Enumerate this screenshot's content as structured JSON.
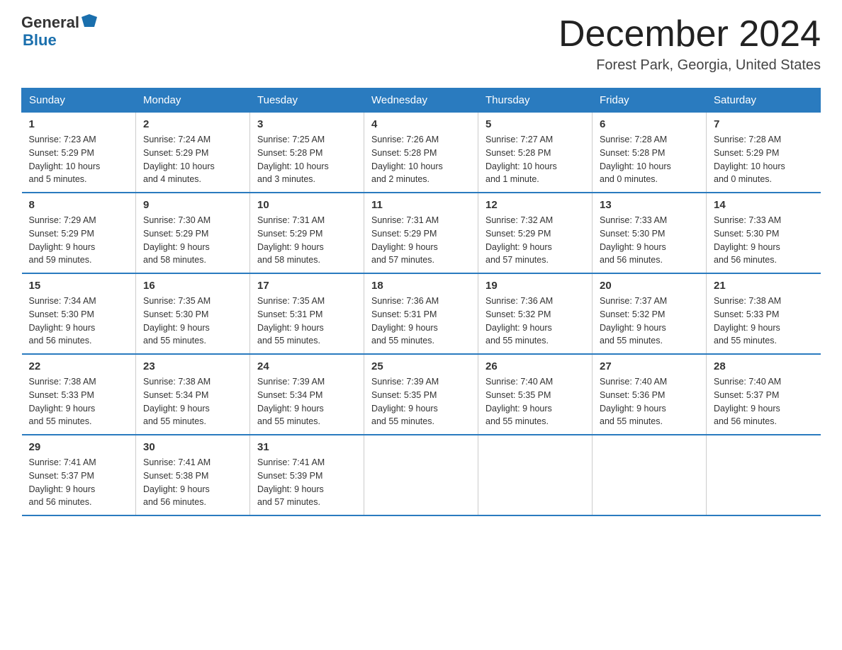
{
  "header": {
    "logo_general": "General",
    "logo_blue": "Blue",
    "month": "December 2024",
    "location": "Forest Park, Georgia, United States"
  },
  "weekdays": [
    "Sunday",
    "Monday",
    "Tuesday",
    "Wednesday",
    "Thursday",
    "Friday",
    "Saturday"
  ],
  "weeks": [
    [
      {
        "day": "1",
        "info": "Sunrise: 7:23 AM\nSunset: 5:29 PM\nDaylight: 10 hours\nand 5 minutes."
      },
      {
        "day": "2",
        "info": "Sunrise: 7:24 AM\nSunset: 5:29 PM\nDaylight: 10 hours\nand 4 minutes."
      },
      {
        "day": "3",
        "info": "Sunrise: 7:25 AM\nSunset: 5:28 PM\nDaylight: 10 hours\nand 3 minutes."
      },
      {
        "day": "4",
        "info": "Sunrise: 7:26 AM\nSunset: 5:28 PM\nDaylight: 10 hours\nand 2 minutes."
      },
      {
        "day": "5",
        "info": "Sunrise: 7:27 AM\nSunset: 5:28 PM\nDaylight: 10 hours\nand 1 minute."
      },
      {
        "day": "6",
        "info": "Sunrise: 7:28 AM\nSunset: 5:28 PM\nDaylight: 10 hours\nand 0 minutes."
      },
      {
        "day": "7",
        "info": "Sunrise: 7:28 AM\nSunset: 5:29 PM\nDaylight: 10 hours\nand 0 minutes."
      }
    ],
    [
      {
        "day": "8",
        "info": "Sunrise: 7:29 AM\nSunset: 5:29 PM\nDaylight: 9 hours\nand 59 minutes."
      },
      {
        "day": "9",
        "info": "Sunrise: 7:30 AM\nSunset: 5:29 PM\nDaylight: 9 hours\nand 58 minutes."
      },
      {
        "day": "10",
        "info": "Sunrise: 7:31 AM\nSunset: 5:29 PM\nDaylight: 9 hours\nand 58 minutes."
      },
      {
        "day": "11",
        "info": "Sunrise: 7:31 AM\nSunset: 5:29 PM\nDaylight: 9 hours\nand 57 minutes."
      },
      {
        "day": "12",
        "info": "Sunrise: 7:32 AM\nSunset: 5:29 PM\nDaylight: 9 hours\nand 57 minutes."
      },
      {
        "day": "13",
        "info": "Sunrise: 7:33 AM\nSunset: 5:30 PM\nDaylight: 9 hours\nand 56 minutes."
      },
      {
        "day": "14",
        "info": "Sunrise: 7:33 AM\nSunset: 5:30 PM\nDaylight: 9 hours\nand 56 minutes."
      }
    ],
    [
      {
        "day": "15",
        "info": "Sunrise: 7:34 AM\nSunset: 5:30 PM\nDaylight: 9 hours\nand 56 minutes."
      },
      {
        "day": "16",
        "info": "Sunrise: 7:35 AM\nSunset: 5:30 PM\nDaylight: 9 hours\nand 55 minutes."
      },
      {
        "day": "17",
        "info": "Sunrise: 7:35 AM\nSunset: 5:31 PM\nDaylight: 9 hours\nand 55 minutes."
      },
      {
        "day": "18",
        "info": "Sunrise: 7:36 AM\nSunset: 5:31 PM\nDaylight: 9 hours\nand 55 minutes."
      },
      {
        "day": "19",
        "info": "Sunrise: 7:36 AM\nSunset: 5:32 PM\nDaylight: 9 hours\nand 55 minutes."
      },
      {
        "day": "20",
        "info": "Sunrise: 7:37 AM\nSunset: 5:32 PM\nDaylight: 9 hours\nand 55 minutes."
      },
      {
        "day": "21",
        "info": "Sunrise: 7:38 AM\nSunset: 5:33 PM\nDaylight: 9 hours\nand 55 minutes."
      }
    ],
    [
      {
        "day": "22",
        "info": "Sunrise: 7:38 AM\nSunset: 5:33 PM\nDaylight: 9 hours\nand 55 minutes."
      },
      {
        "day": "23",
        "info": "Sunrise: 7:38 AM\nSunset: 5:34 PM\nDaylight: 9 hours\nand 55 minutes."
      },
      {
        "day": "24",
        "info": "Sunrise: 7:39 AM\nSunset: 5:34 PM\nDaylight: 9 hours\nand 55 minutes."
      },
      {
        "day": "25",
        "info": "Sunrise: 7:39 AM\nSunset: 5:35 PM\nDaylight: 9 hours\nand 55 minutes."
      },
      {
        "day": "26",
        "info": "Sunrise: 7:40 AM\nSunset: 5:35 PM\nDaylight: 9 hours\nand 55 minutes."
      },
      {
        "day": "27",
        "info": "Sunrise: 7:40 AM\nSunset: 5:36 PM\nDaylight: 9 hours\nand 55 minutes."
      },
      {
        "day": "28",
        "info": "Sunrise: 7:40 AM\nSunset: 5:37 PM\nDaylight: 9 hours\nand 56 minutes."
      }
    ],
    [
      {
        "day": "29",
        "info": "Sunrise: 7:41 AM\nSunset: 5:37 PM\nDaylight: 9 hours\nand 56 minutes."
      },
      {
        "day": "30",
        "info": "Sunrise: 7:41 AM\nSunset: 5:38 PM\nDaylight: 9 hours\nand 56 minutes."
      },
      {
        "day": "31",
        "info": "Sunrise: 7:41 AM\nSunset: 5:39 PM\nDaylight: 9 hours\nand 57 minutes."
      },
      {
        "day": "",
        "info": ""
      },
      {
        "day": "",
        "info": ""
      },
      {
        "day": "",
        "info": ""
      },
      {
        "day": "",
        "info": ""
      }
    ]
  ]
}
